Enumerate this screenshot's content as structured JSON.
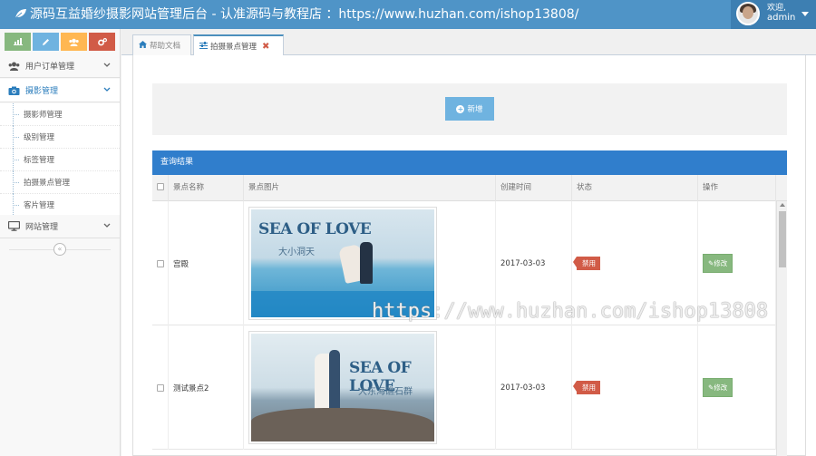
{
  "header": {
    "title": "源码互益婚纱摄影网站管理后台 - 认准源码与教程店 ：https://www.huzhan.com/ishop13808/",
    "welcome": "欢迎,",
    "username": "admin"
  },
  "sidebar": {
    "shortcuts": [
      {
        "icon": "bar-chart-icon",
        "color": "#87b87f"
      },
      {
        "icon": "pencil-icon",
        "color": "#6fb3e0"
      },
      {
        "icon": "users-icon",
        "color": "#ffb752"
      },
      {
        "icon": "cogs-icon",
        "color": "#d15b47"
      }
    ],
    "groups": [
      {
        "label": "用户订单管理",
        "icon": "users-icon"
      },
      {
        "label": "摄影管理",
        "icon": "camera-icon",
        "active": true
      },
      {
        "label": "网站管理",
        "icon": "desktop-icon"
      }
    ],
    "sub_items": [
      "摄影师管理",
      "级别管理",
      "标签管理",
      "拍摄景点管理",
      "客片管理"
    ],
    "collapse_glyph": "«"
  },
  "tabs": [
    {
      "label": "帮助文档",
      "icon": "home-icon"
    },
    {
      "label": "拍摄景点管理",
      "icon": "sliders-icon",
      "active": true,
      "close": "✖"
    }
  ],
  "toolbar": {
    "add_label": "新增"
  },
  "results": {
    "title": "查询结果",
    "columns": [
      "景点名称",
      "景点图片",
      "创建时间",
      "状态",
      "操作"
    ],
    "rows": [
      {
        "name": "宫殿",
        "image_title": "SEA OF LOVE",
        "image_subtitle": "大小洞天",
        "created": "2017-03-03",
        "status": "禁用",
        "action": "修改"
      },
      {
        "name": "测试景点2",
        "image_title": "SEA OF LOVE",
        "image_subtitle": "大东海礁石群",
        "created": "2017-03-03",
        "status": "禁用",
        "action": "修改"
      }
    ]
  },
  "watermark": "https://www.huzhan.com/ishop13808",
  "colors": {
    "topbar": "#4f94c7",
    "results_header": "#307ecc",
    "status_disabled": "#d15b47",
    "edit_button": "#87b87f",
    "add_button": "#6fb3e0"
  }
}
